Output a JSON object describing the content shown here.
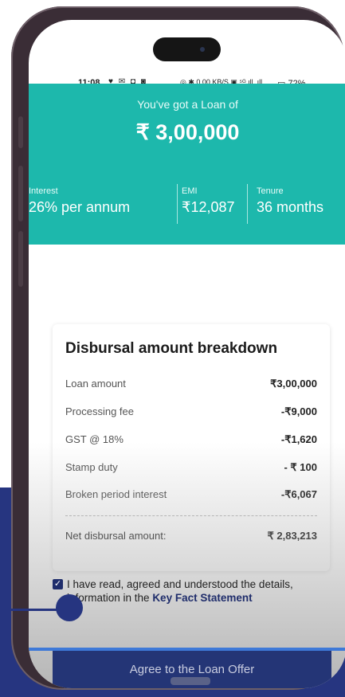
{
  "status_bar": {
    "time": "11:08",
    "left_icons": "♥ ✉ ◘ ◙",
    "right_icons": "◎ ✱ 0.00 KB/S ▣ ⁵ᴳ.ıll .ıll",
    "battery": "72%"
  },
  "loan": {
    "heading": "You've got a Loan of",
    "amount": "₹ 3,00,000",
    "interest_label": "Interest",
    "interest_value": "26% per annum",
    "emi_label": "EMI",
    "emi_value": "₹12,087",
    "tenure_label": "Tenure",
    "tenure_value": "36 months"
  },
  "breakdown": {
    "title": "Disbursal amount breakdown",
    "rows": [
      {
        "label": "Loan amount",
        "value": "₹3,00,000"
      },
      {
        "label": "Processing fee",
        "value": "-₹9,000"
      },
      {
        "label": "GST @ 18%",
        "value": "-₹1,620"
      },
      {
        "label": "Stamp duty",
        "value": "- ₹ 100"
      },
      {
        "label": "Broken period interest",
        "value": "-₹6,067"
      }
    ],
    "net_label": "Net disbursal amount:",
    "net_value": "₹ 2,83,213"
  },
  "consent": {
    "checked": true,
    "text_before": "I have read, agreed and understood the details, information in the ",
    "link_text": "Key Fact Statement"
  },
  "cta": {
    "label": "Agree to the Loan Offer"
  },
  "colors": {
    "hero": "#1db8ac",
    "brand_navy": "#243576",
    "background_band": "#263580"
  }
}
